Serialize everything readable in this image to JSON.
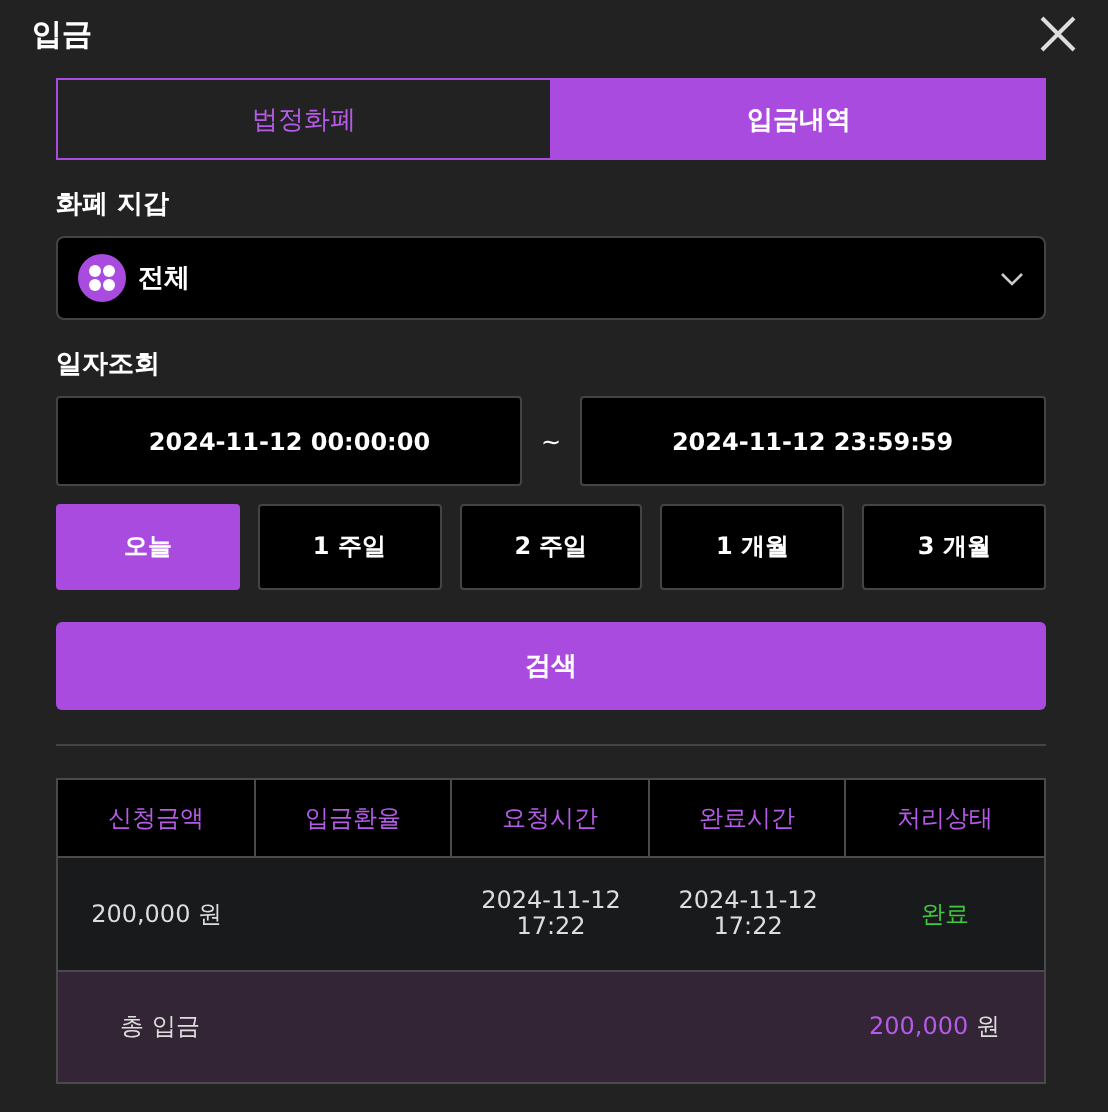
{
  "title": "입금",
  "tabs": [
    {
      "label": "법정화폐",
      "selected": false
    },
    {
      "label": "입금내역",
      "selected": true
    }
  ],
  "wallet": {
    "label": "화폐 지갑",
    "value": "전체"
  },
  "date_query": {
    "label": "일자조회",
    "from": "2024-11-12 00:00:00",
    "separator": "~",
    "to": "2024-11-12 23:59:59"
  },
  "periods": [
    {
      "label": "오늘",
      "selected": true
    },
    {
      "label": "1 주일",
      "selected": false
    },
    {
      "label": "2 주일",
      "selected": false
    },
    {
      "label": "1 개월",
      "selected": false
    },
    {
      "label": "3 개월",
      "selected": false
    }
  ],
  "search_button": "검색",
  "table": {
    "columns": [
      "신청금액",
      "입금환율",
      "요청시간",
      "완료시간",
      "처리상태"
    ],
    "rows": [
      {
        "amount": "200,000 원",
        "requested": "2024-11-12 17:22",
        "completed": "2024-11-12 17:22",
        "status": "완료"
      }
    ],
    "total": {
      "label": "총 입금",
      "amount": "200,000",
      "unit": "원"
    }
  }
}
